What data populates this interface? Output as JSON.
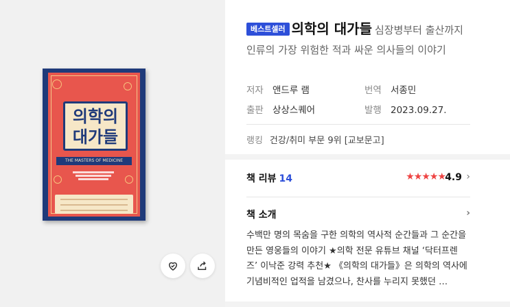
{
  "book": {
    "badge": "베스트셀러",
    "title": "의학의 대가들",
    "subtitle": "심장병부터 출산까지 인류의 가장 위험한 적과 싸운 의사들의 이야기",
    "cover": {
      "title_line1": "의학의",
      "title_line2": "대가들",
      "english_title": "THE MASTERS OF MEDICINE",
      "colors": {
        "frame": "#1f3a7a",
        "background": "#e8564d",
        "panel": "#f6e7c7"
      }
    }
  },
  "details": {
    "author_label": "저자",
    "author": "앤드루 램",
    "translator_label": "번역",
    "translator": "서종민",
    "publisher_label": "출판",
    "publisher": "상상스퀘어",
    "date_label": "발행",
    "date": "2023.09.27."
  },
  "ranking": {
    "label": "랭킹",
    "value": "건강/취미 부문 9위 [교보문고]"
  },
  "review": {
    "label": "책 리뷰",
    "count": "14",
    "rating": "4.9",
    "stars": 5,
    "star_color": "#ee4443"
  },
  "intro": {
    "label": "책 소개",
    "text": "수백만 명의 목숨을 구한 의학의 역사적 순간들과 그 순간을 만든 영웅들의 이야기 ★의학 전문 유튜브 채널 ‘닥터프렌즈’ 이낙준 강력 추천★ 《의학의 대가들》은 의학의 역사에 기념비적인 업적을 남겼으나, 찬사를 누리지 못했던 …"
  },
  "actions": {
    "like_icon": "heart-icon",
    "share_icon": "share-icon"
  },
  "accent_color": "#2d4fd9"
}
